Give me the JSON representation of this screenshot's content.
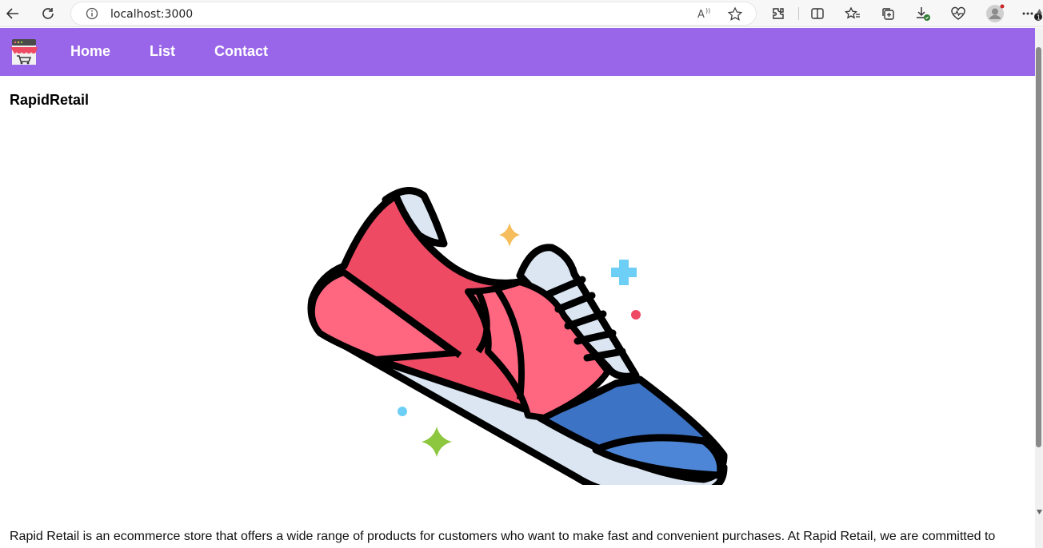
{
  "browser": {
    "url": "localhost:3000",
    "icons": [
      "back-icon",
      "refresh-icon",
      "info-icon",
      "read-aloud-icon",
      "favorite-star-icon",
      "extensions-icon",
      "split-screen-icon",
      "favorites-icon",
      "collections-icon",
      "downloads-icon",
      "browser-essentials-icon",
      "profile-icon",
      "more-icon"
    ]
  },
  "nav": {
    "links": [
      {
        "label": "Home"
      },
      {
        "label": "List"
      },
      {
        "label": "Contact"
      }
    ],
    "color": "#9966ea"
  },
  "page": {
    "brand": "RapidRetail",
    "about": "Rapid Retail is an ecommerce store that offers a wide range of products for customers who want to make fast and convenient purchases. At Rapid Retail, we are committed to"
  },
  "colors": {
    "shoe_red": "#ee4a64",
    "shoe_pink": "#ff6680",
    "shoe_blue": "#3d73c4",
    "shoe_sole": "#dbe6f2",
    "sparkle_yellow": "#f5bd5b",
    "sparkle_blue": "#6dcff5",
    "sparkle_green": "#8dc63f"
  }
}
